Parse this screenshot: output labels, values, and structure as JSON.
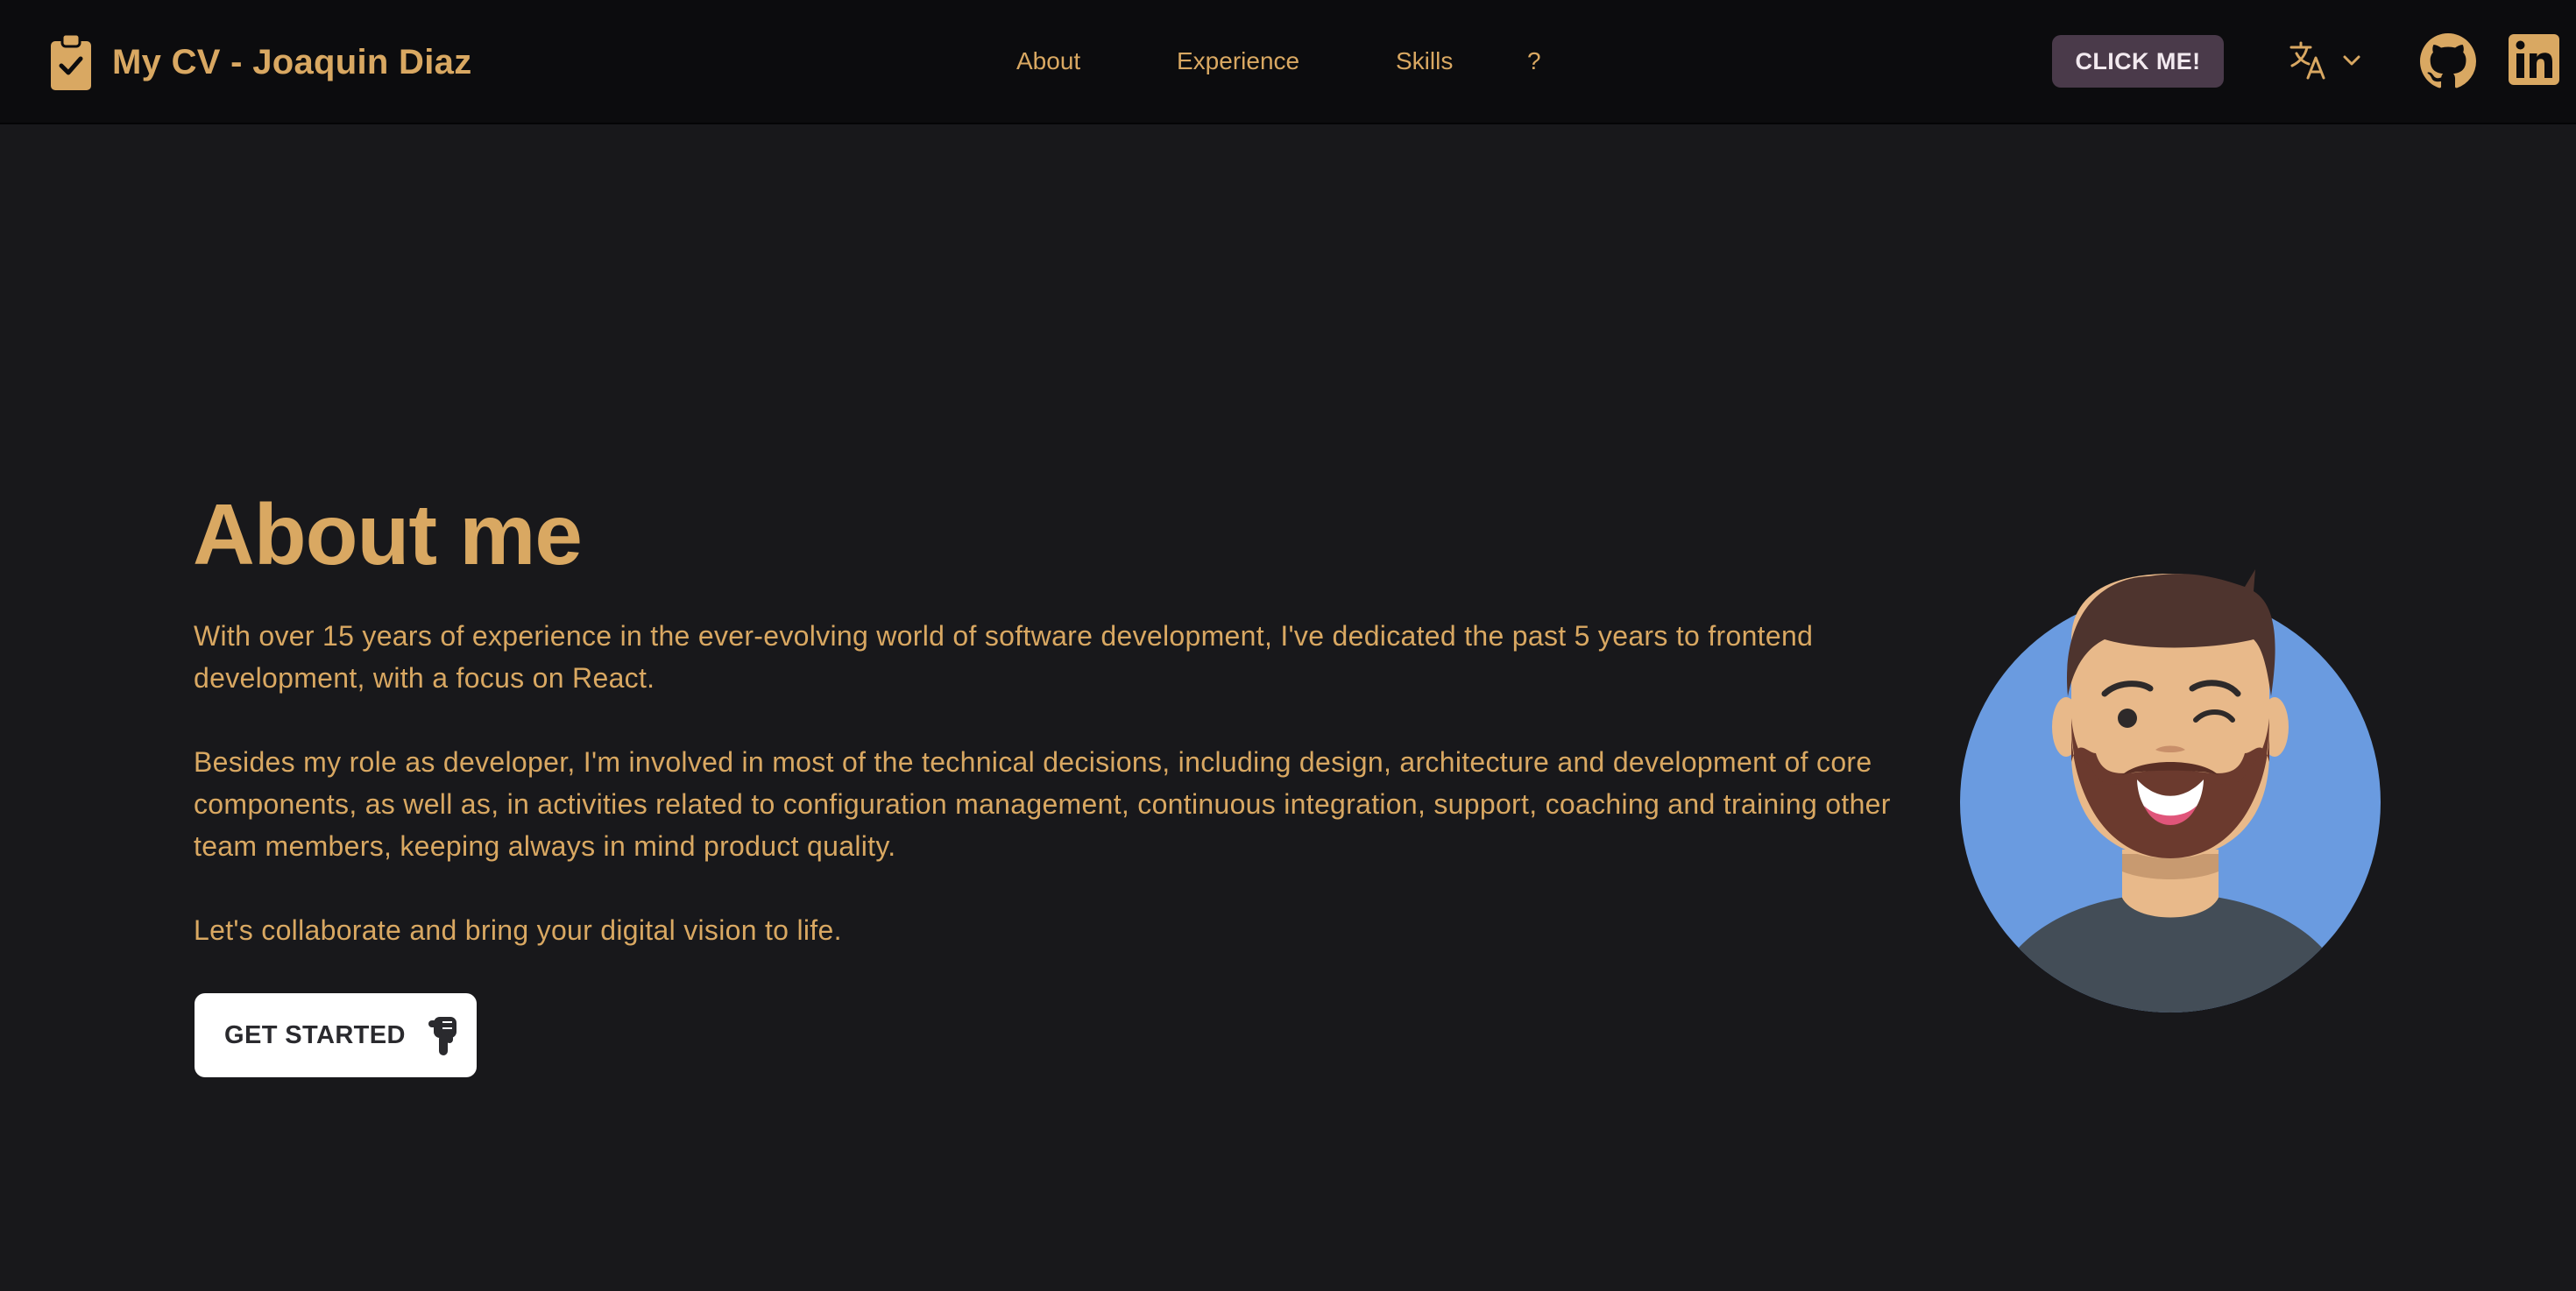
{
  "header": {
    "brand_title": "My CV - Joaquin Diaz",
    "brand_icon": "clipboard-check-icon",
    "nav": [
      {
        "label": "About"
      },
      {
        "label": "Experience"
      },
      {
        "label": "Skills"
      },
      {
        "label": "?"
      }
    ],
    "cta_label": "CLICK ME!",
    "language_icon": "translate-icon",
    "social": [
      "github-icon",
      "linkedin-icon"
    ]
  },
  "about": {
    "title": "About me",
    "paragraphs": [
      "With over 15 years of experience in the ever-evolving world of software development, I've dedicated the past 5 years to frontend development, with a focus on React.",
      "Besides my role as developer, I'm involved in most of the technical decisions, including design, architecture and development of core components, as well as, in activities related to configuration management, continuous integration, support, coaching and training other team members, keeping always in mind product quality.",
      "Let's collaborate and bring your digital vision to life."
    ],
    "start_label": "GET STARTED",
    "start_icon": "pointing-down-hand-icon",
    "avatar": "winking-bearded-man-avatar"
  },
  "colors": {
    "accent": "#d9a862",
    "background": "#18181b",
    "header": "#0c0c0e",
    "cta_bg": "#4a3a4a",
    "avatar_bg": "#6a9be0"
  }
}
